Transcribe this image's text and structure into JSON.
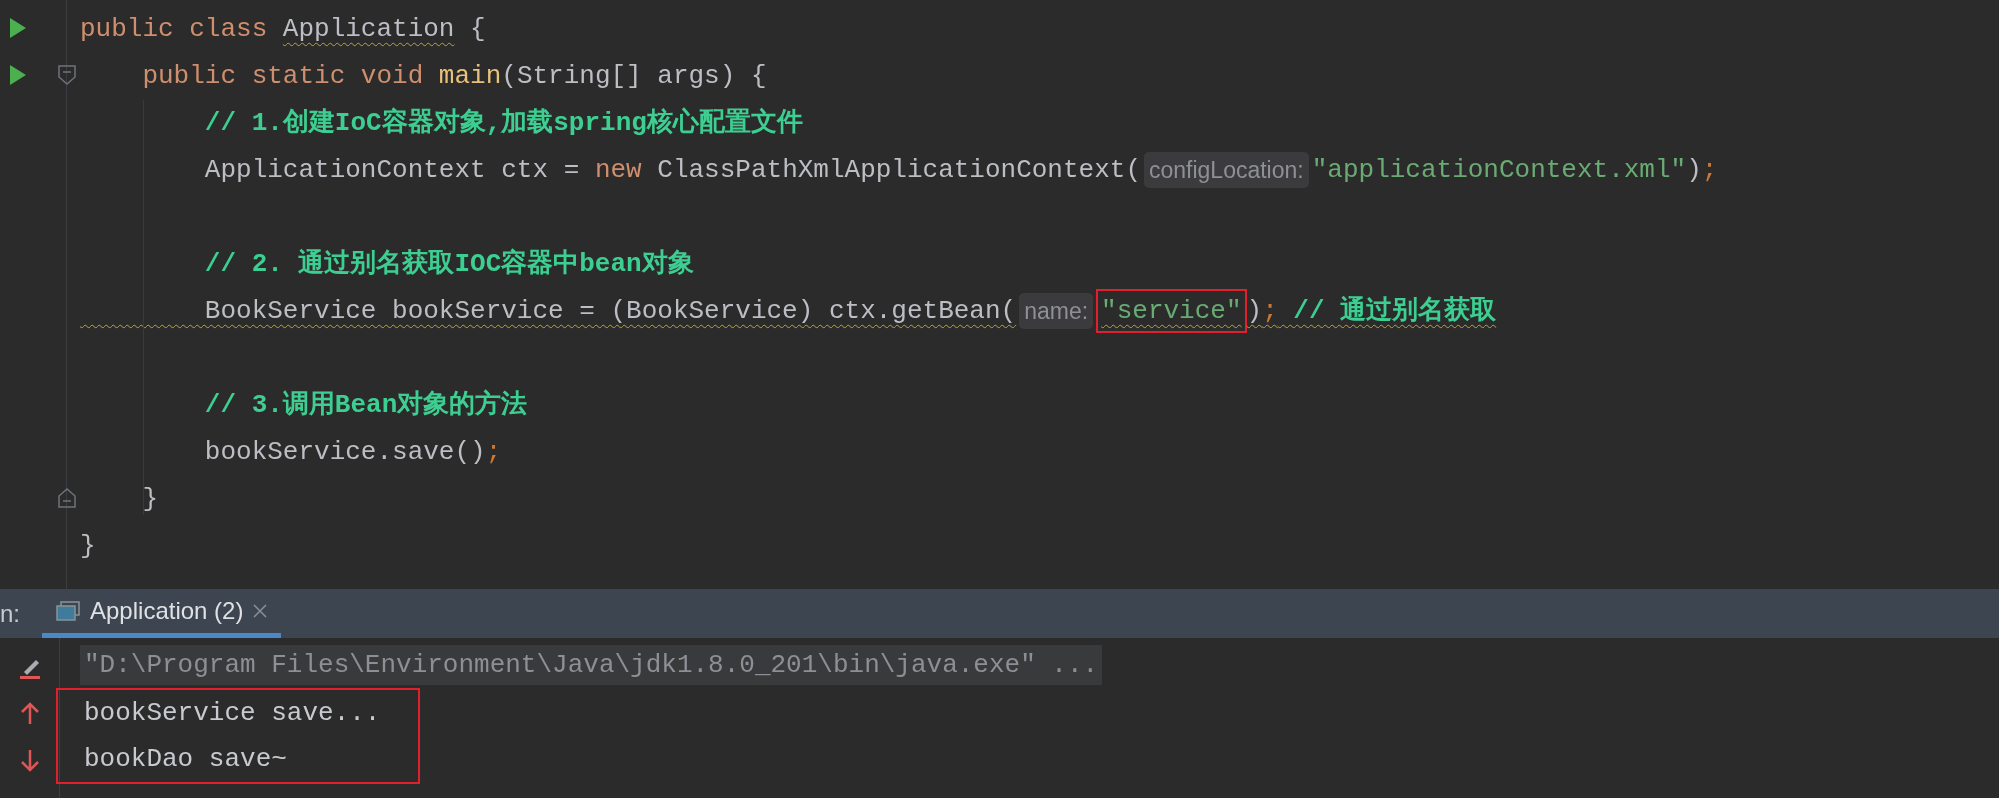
{
  "editor": {
    "lines": [
      {
        "run": true,
        "fold_start": false,
        "fold_end": false,
        "tokens": [
          {
            "text": "public class ",
            "kind": "keyword",
            "warning": false,
            "boxed": false
          },
          {
            "text": "Application",
            "kind": "plain",
            "warning": true,
            "boxed": false
          },
          {
            "text": " {",
            "kind": "plain",
            "warning": false,
            "boxed": false
          }
        ]
      },
      {
        "run": true,
        "fold_start": true,
        "fold_end": false,
        "tokens": [
          {
            "text": "    public static void ",
            "kind": "keyword",
            "warning": false,
            "boxed": false
          },
          {
            "text": "main",
            "kind": "method",
            "warning": false,
            "boxed": false
          },
          {
            "text": "(String[] args) {",
            "kind": "plain",
            "warning": false,
            "boxed": false
          }
        ]
      },
      {
        "run": false,
        "fold_start": false,
        "fold_end": false,
        "tokens": [
          {
            "text": "        // 1.创建IoC容器对象,加载spring核心配置文件",
            "kind": "comment",
            "warning": false,
            "boxed": false
          }
        ]
      },
      {
        "run": false,
        "fold_start": false,
        "fold_end": false,
        "tokens": [
          {
            "text": "        ApplicationContext ctx = ",
            "kind": "plain",
            "warning": false,
            "boxed": false
          },
          {
            "text": "new",
            "kind": "keyword",
            "warning": false,
            "boxed": false
          },
          {
            "text": " ClassPathXmlApplicationContext(",
            "kind": "plain",
            "warning": false,
            "boxed": false
          },
          {
            "text": "configLocation:",
            "kind": "hint",
            "warning": false,
            "boxed": false
          },
          {
            "text": "\"applicationContext.xml\"",
            "kind": "string",
            "warning": false,
            "boxed": false
          },
          {
            "text": ")",
            "kind": "plain",
            "warning": false,
            "boxed": false
          },
          {
            "text": ";",
            "kind": "semicolon",
            "warning": false,
            "boxed": false
          }
        ]
      },
      {
        "run": false,
        "fold_start": false,
        "fold_end": false
      },
      {
        "run": false,
        "fold_start": false,
        "fold_end": false,
        "tokens": [
          {
            "text": "        // 2. 通过别名获取IOC容器中bean对象",
            "kind": "comment",
            "warning": false,
            "boxed": false
          }
        ]
      },
      {
        "run": false,
        "fold_start": false,
        "fold_end": false,
        "tokens": [
          {
            "text": "        BookService bookService = (BookService) ctx.getBean(",
            "kind": "plain",
            "warning": true,
            "boxed": false
          },
          {
            "text": "name:",
            "kind": "hint",
            "warning": false,
            "boxed": false
          },
          {
            "text": "\"service\"",
            "kind": "string",
            "warning": true,
            "boxed": true
          },
          {
            "text": ")",
            "kind": "plain",
            "warning": true,
            "boxed": false
          },
          {
            "text": ";",
            "kind": "semicolon",
            "warning": true,
            "boxed": false
          },
          {
            "text": " // 通过别名获取",
            "kind": "comment",
            "warning": true,
            "boxed": false
          }
        ]
      },
      {
        "run": false,
        "fold_start": false,
        "fold_end": false
      },
      {
        "run": false,
        "fold_start": false,
        "fold_end": false,
        "tokens": [
          {
            "text": "        // 3.调用Bean对象的方法",
            "kind": "comment",
            "warning": false,
            "boxed": false
          }
        ]
      },
      {
        "run": false,
        "fold_start": false,
        "fold_end": false,
        "tokens": [
          {
            "text": "        bookService.save()",
            "kind": "plain",
            "warning": false,
            "boxed": false
          },
          {
            "text": ";",
            "kind": "semicolon",
            "warning": false,
            "boxed": false
          }
        ]
      },
      {
        "run": false,
        "fold_start": false,
        "fold_end": true,
        "tokens": [
          {
            "text": "    }",
            "kind": "plain",
            "warning": false,
            "boxed": false
          }
        ]
      },
      {
        "run": false,
        "fold_start": false,
        "fold_end": false,
        "tokens": [
          {
            "text": "}",
            "kind": "plain",
            "warning": false,
            "boxed": false
          }
        ]
      }
    ]
  },
  "run_panel": {
    "label": "n:",
    "tabs": [
      {
        "title": "Application (2)",
        "selected": true
      }
    ],
    "console": [
      {
        "text": "\"D:\\Program Files\\Environment\\Java\\jdk1.8.0_201\\bin\\java.exe\" ...",
        "kind": "command",
        "boxed": false
      },
      {
        "text": "bookService save...",
        "kind": "output",
        "boxed": true
      },
      {
        "text": "bookDao save~",
        "kind": "output",
        "boxed": true
      }
    ]
  }
}
